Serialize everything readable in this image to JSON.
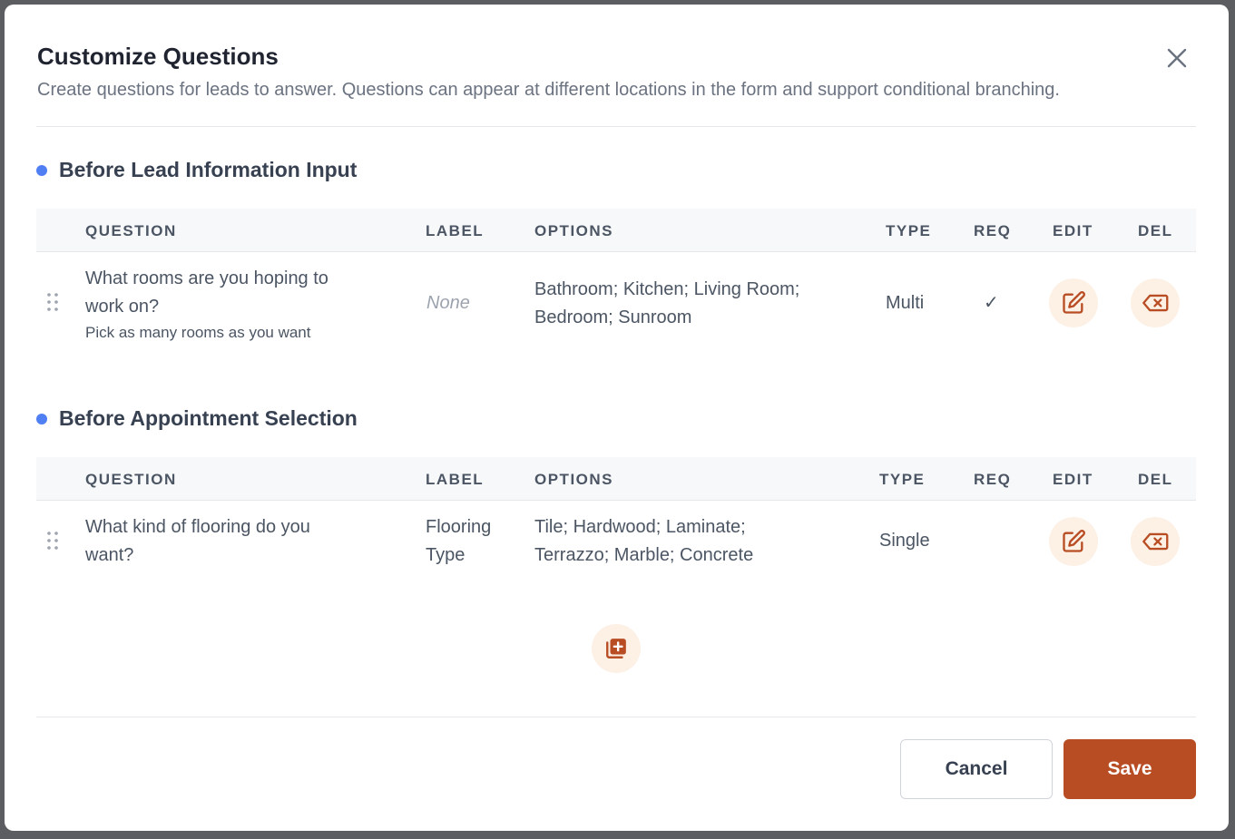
{
  "modal": {
    "title": "Customize Questions",
    "subtitle": "Create questions for leads to answer. Questions can appear at different locations in the form and support conditional branching."
  },
  "columns": {
    "question": "QUESTION",
    "label": "LABEL",
    "options": "OPTIONS",
    "type": "TYPE",
    "req": "REQ",
    "edit": "EDIT",
    "del": "DEL"
  },
  "sections": [
    {
      "title": "Before Lead Information Input",
      "rows": [
        {
          "question_line1": "What rooms are you hoping to",
          "question_line2": "work on?",
          "hint": "Pick as many rooms as you want",
          "label": "None",
          "options_line1": "Bathroom; Kitchen; Living Room;",
          "options_line2": "Bedroom; Sunroom",
          "type": "Multi",
          "req": "✓"
        }
      ]
    },
    {
      "title": "Before Appointment Selection",
      "rows": [
        {
          "question_line1": "What kind of flooring do you",
          "question_line2": "want?",
          "label_line1": "Flooring",
          "label_line2": "Type",
          "options_line1": "Tile; Hardwood; Laminate;",
          "options_line2": "Terrazzo; Marble; Concrete",
          "type": "Single",
          "req": ""
        }
      ]
    }
  ],
  "footer": {
    "cancel_label": "Cancel",
    "save_label": "Save"
  },
  "colors": {
    "accent": "#b84d24",
    "icon_bg": "#fdf1e6",
    "section_dot": "#4f7ff2"
  },
  "icons": {
    "close": "close-icon",
    "drag": "drag-handle-icon",
    "edit": "edit-icon",
    "delete": "backspace-delete-icon",
    "add": "add-question-icon"
  }
}
